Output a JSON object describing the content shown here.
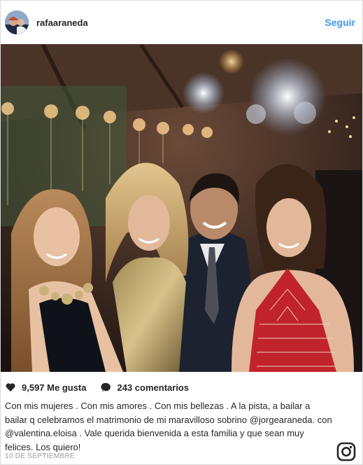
{
  "header": {
    "username": "rafaaraneda",
    "follow_label": "Seguir"
  },
  "photo": {
    "description_icon": "photo"
  },
  "stats": {
    "likes": "9,597 Me gusta",
    "comments": "243 comentarios"
  },
  "caption": {
    "text_1": "Con mis mujeres . Con mis amores . Con mis bellezas . A la pista, a bailar a bailar q celebramos el matrimonio de mi maravilloso sobrino ",
    "mention_1": "@jorgearaneda",
    "text_2": ". con ",
    "mention_2": "@valentina.eloisa",
    "text_3": " . Vale querida bienvenida a esta familia y que sean muy felices. Los quiero!"
  },
  "timestamp": "10 DE SEPTIEMBRE",
  "colors": {
    "link": "#3897f0",
    "text": "#262626",
    "muted": "#999999",
    "border": "#dbdbdb"
  },
  "icons": [
    "heart-icon",
    "comment-bubble-icon",
    "instagram-logo-icon"
  ]
}
